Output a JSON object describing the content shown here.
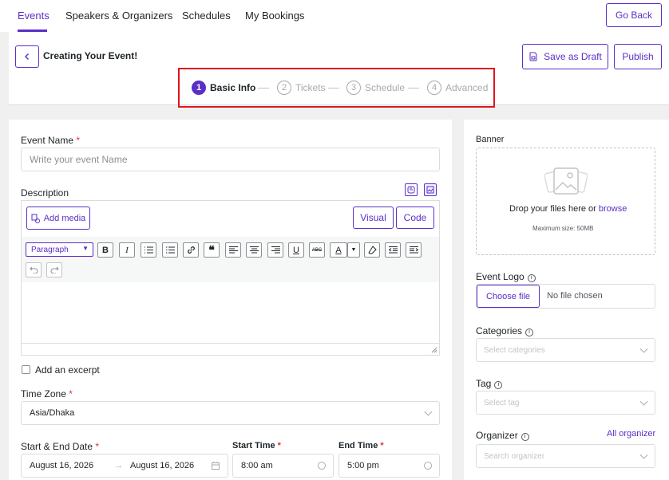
{
  "nav": {
    "tabs": [
      "Events",
      "Speakers & Organizers",
      "Schedules",
      "My Bookings"
    ],
    "go_back": "Go Back"
  },
  "header": {
    "title": "Creating Your Event!",
    "save_draft": "Save as Draft",
    "publish": "Publish"
  },
  "steps": [
    {
      "num": "1",
      "label": "Basic Info"
    },
    {
      "num": "2",
      "label": "Tickets"
    },
    {
      "num": "3",
      "label": "Schedule"
    },
    {
      "num": "4",
      "label": "Advanced"
    }
  ],
  "form": {
    "event_name_label": "Event Name",
    "event_name_placeholder": "Write your event Name",
    "required_mark": "*",
    "description_label": "Description",
    "add_media": "Add media",
    "visual": "Visual",
    "code": "Code",
    "paragraph": "Paragraph",
    "excerpt_label": "Add an excerpt",
    "timezone_label": "Time Zone",
    "timezone_value": "Asia/Dhaka",
    "date_label": "Start & End Date",
    "start_date": "August 16, 2026",
    "end_date": "August 16, 2026",
    "start_time_label": "Start Time",
    "start_time": "8:00 am",
    "end_time_label": "End Time",
    "end_time": "5:00 pm"
  },
  "sidebar": {
    "banner_label": "Banner",
    "drop_text": "Drop your files here or",
    "browse": "browse",
    "max_size": "Maximum size: 50MB",
    "logo_label": "Event Logo",
    "choose_file": "Choose file",
    "no_file": "No file chosen",
    "categories_label": "Categories",
    "categories_placeholder": "Select categories",
    "tag_label": "Tag",
    "tag_placeholder": "Select tag",
    "organizer_label": "Organizer",
    "all_organizer": "All organizer",
    "organizer_placeholder": "Search organizer"
  },
  "colors": {
    "accent": "#5b2ec7",
    "highlight": "#e1141c",
    "required": "#d63638"
  }
}
